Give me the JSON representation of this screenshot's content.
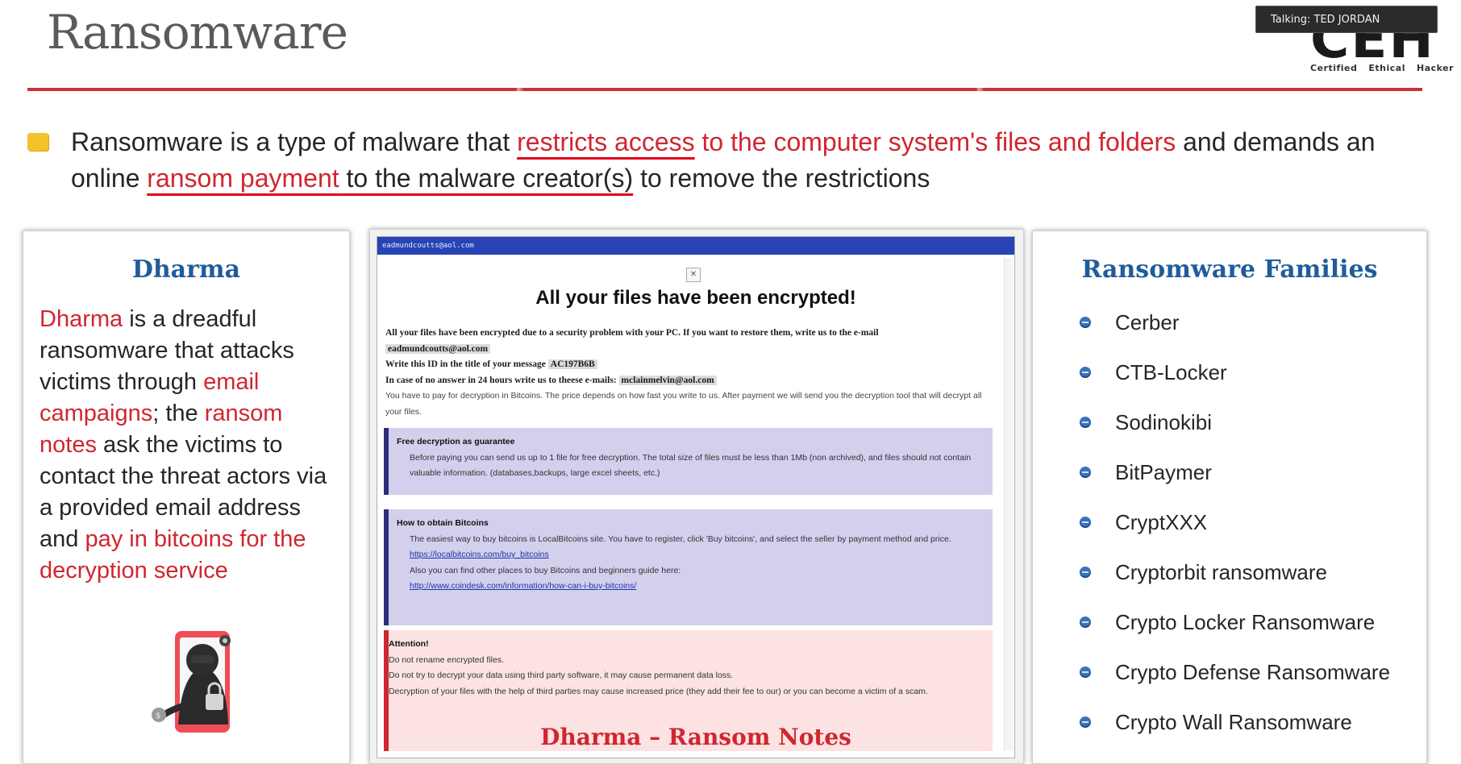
{
  "slide": {
    "title": "Ransomware",
    "intro": {
      "p1": "Ransomware is a type of malware that ",
      "p2": "restricts access",
      "p3": " to the computer system's files and folders",
      "p4": " and demands an online ",
      "p5": "ransom payment",
      "p6": " to the malware creator(s)",
      "p7": " to remove the restrictions"
    }
  },
  "logo": {
    "letters": "CEH",
    "sub": [
      "Certified",
      "Ethical",
      "Hacker"
    ]
  },
  "meeting": {
    "talking": "Talking: TED JORDAN"
  },
  "dharma": {
    "title": "Dharma",
    "t1": "Dharma",
    "t2": " is a dreadful ransomware that attacks victims through ",
    "t3": "email campaigns",
    "t4": "; the ",
    "t5": "ransom notes",
    "t6": " ask the victims to contact the threat actors via a provided email address and ",
    "t7": "pay in bitcoins for the decryption service"
  },
  "ransom_note": {
    "window_title": "eadmundcoutts@aol.com",
    "heading": "All your files have been encrypted!",
    "line1": "All your files have been encrypted due to a security problem with your PC. If you want to restore them, write us to the e-mail",
    "email1": "eadmundcoutts@aol.com",
    "line2": "Write this ID in the title of your message",
    "id": "AC197B6B",
    "line3": "In case of no answer in 24 hours write us to theese e-mails:",
    "email2": "mclainmelvin@aol.com",
    "line4": "You have to pay for decryption in Bitcoins. The price depends on how fast you write to us. After payment we will send you the decryption tool that will decrypt all your files.",
    "box1_head": "Free decryption as guarantee",
    "box1_text": "Before paying you can send us up to 1 file for free decryption. The total size of files must be less than 1Mb (non archived), and files should not contain valuable information. (databases,backups, large excel sheets, etc.)",
    "box2_head": "How to obtain Bitcoins",
    "box2_text1": "The easiest way to buy bitcoins is LocalBitcoins site. You have to register, click 'Buy bitcoins', and select the seller by payment method and price.",
    "box2_link1": "https://localbitcoins.com/buy_bitcoins",
    "box2_text2": "Also you can find other places to buy Bitcoins and beginners guide here:",
    "box2_link2": "http://www.coindesk.com/information/how-can-i-buy-bitcoins/",
    "box3_head": "Attention!",
    "box3_l1": "Do not rename encrypted files.",
    "box3_l2": "Do not try to decrypt your data using third party software, it may cause permanent data loss.",
    "box3_l3": "Decryption of your files with the help of third parties may cause increased price (they add their fee to our) or you can become a victim of a scam.",
    "caption": "Dharma – Ransom Notes"
  },
  "families": {
    "title": "Ransomware Families",
    "items": [
      "Cerber",
      "CTB-Locker",
      "Sodinokibi",
      "BitPaymer",
      "CryptXXX",
      "Cryptorbit ransomware",
      "Crypto Locker Ransomware",
      "Crypto Defense Ransomware",
      "Crypto Wall Ransomware"
    ]
  },
  "colors": {
    "accent_red": "#d0262f",
    "heading_blue": "#1f5c9c",
    "bullet_yellow": "#f4c22b",
    "bullet_blue": "#3a72b8",
    "note_titlebar": "#2743b5"
  }
}
